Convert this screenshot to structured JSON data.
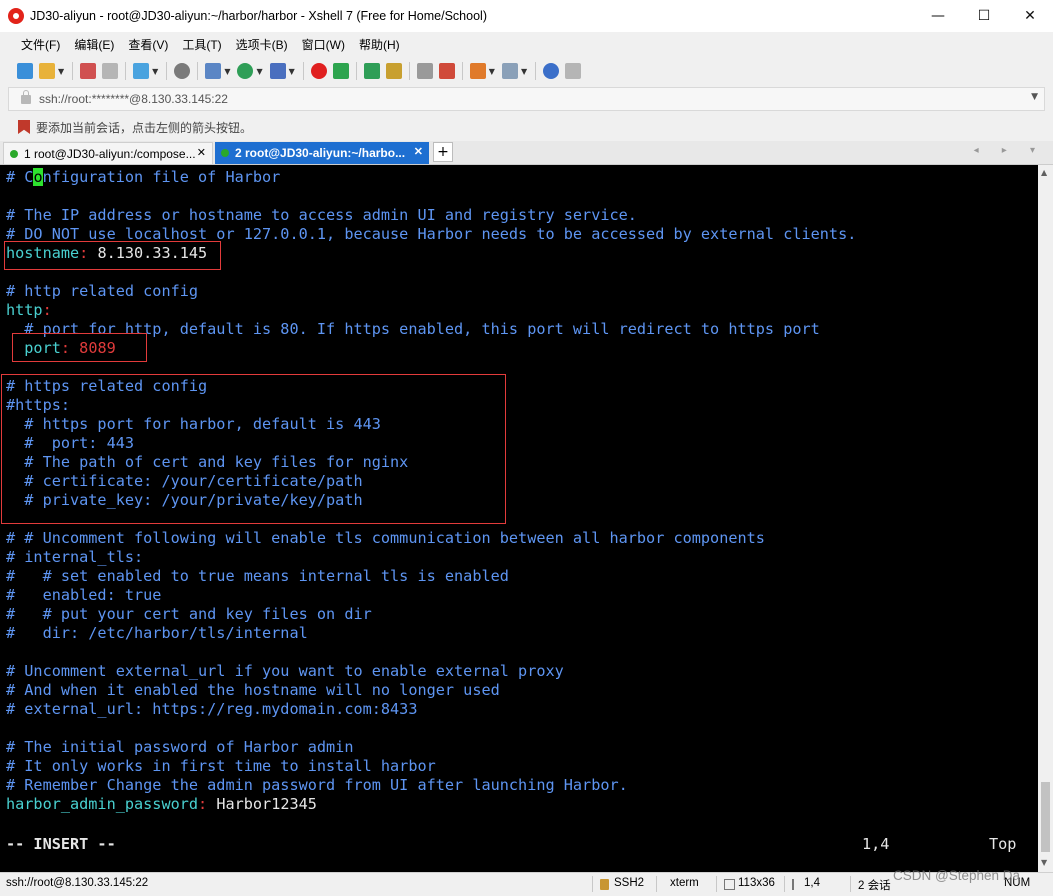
{
  "window": {
    "title": "JD30-aliyun - root@JD30-aliyun:~/harbor/harbor - Xshell 7 (Free for Home/School)",
    "controls": {
      "minimize": "—",
      "maximize": "☐",
      "close": "✕"
    }
  },
  "menu": [
    "文件(F)",
    "编辑(E)",
    "查看(V)",
    "工具(T)",
    "选项卡(B)",
    "窗口(W)",
    "帮助(H)"
  ],
  "address": {
    "value": "ssh://root:********@8.130.33.145:22"
  },
  "hint": "要添加当前会话，点击左侧的箭头按钮。",
  "tabs": [
    {
      "label": "1 root@JD30-aliyun:/compose...",
      "close": "✕",
      "active": false
    },
    {
      "label": "2 root@JD30-aliyun:~/harbo...",
      "close": "✕",
      "active": true
    }
  ],
  "tab_add": "+",
  "tab_nav": "◂ ▸ ▾",
  "terminal": {
    "lines": {
      "l1_pre": "# C",
      "l1_cursor": "o",
      "l1_post": "nfiguration file of Harbor",
      "l3": "# The IP address or hostname to access admin UI and registry service.",
      "l4": "# DO NOT use localhost or 127.0.0.1, because Harbor needs to be accessed by external clients.",
      "l5_key": "hostname",
      "l5_colon": ":",
      "l5_val": " 8.130.33.145",
      "l7": "# http related config",
      "l8_key": "http",
      "l8_colon": ":",
      "l9": "  # port for http, default is 80. If https enabled, this port will redirect to https port",
      "l10_key": "  port",
      "l10_colon": ":",
      "l10_val": " 8089",
      "l12": "# https related config",
      "l13": "#https:",
      "l14": "  # https port for harbor, default is 443",
      "l15": "  #  port: 443",
      "l16": "  # The path of cert and key files for nginx",
      "l17": "  # certificate: /your/certificate/path",
      "l18": "  # private_key: /your/private/key/path",
      "l20": "# # Uncomment following will enable tls communication between all harbor components",
      "l21": "# internal_tls:",
      "l22": "#   # set enabled to true means internal tls is enabled",
      "l23": "#   enabled: true",
      "l24": "#   # put your cert and key files on dir",
      "l25": "#   dir: /etc/harbor/tls/internal",
      "l27": "# Uncomment external_url if you want to enable external proxy",
      "l28": "# And when it enabled the hostname will no longer used",
      "l29": "# external_url: https://reg.mydomain.com:8433",
      "l31": "# The initial password of Harbor admin",
      "l32": "# It only works in first time to install harbor",
      "l33": "# Remember Change the admin password from UI after launching Harbor.",
      "l34_key": "harbor_admin_password",
      "l34_colon": ":",
      "l34_val": " Harbor12345"
    },
    "mode": "-- INSERT --",
    "position": "1,4",
    "scroll": "Top"
  },
  "status": {
    "connection": "ssh://root@8.130.33.145:22",
    "protocol": "SSH2",
    "term": "xterm",
    "size": "113x36",
    "cursor": "1,4",
    "sessions": "2 会话",
    "num": "NUM"
  },
  "watermark": "CSDN @Stephen Da",
  "colors": {
    "terminal_bg": "#000000",
    "comment": "#5e95f2",
    "key": "#49d0d0",
    "value_red": "#e03b3b",
    "cursor": "#2ee22e",
    "active_tab": "#1e6fd1"
  }
}
